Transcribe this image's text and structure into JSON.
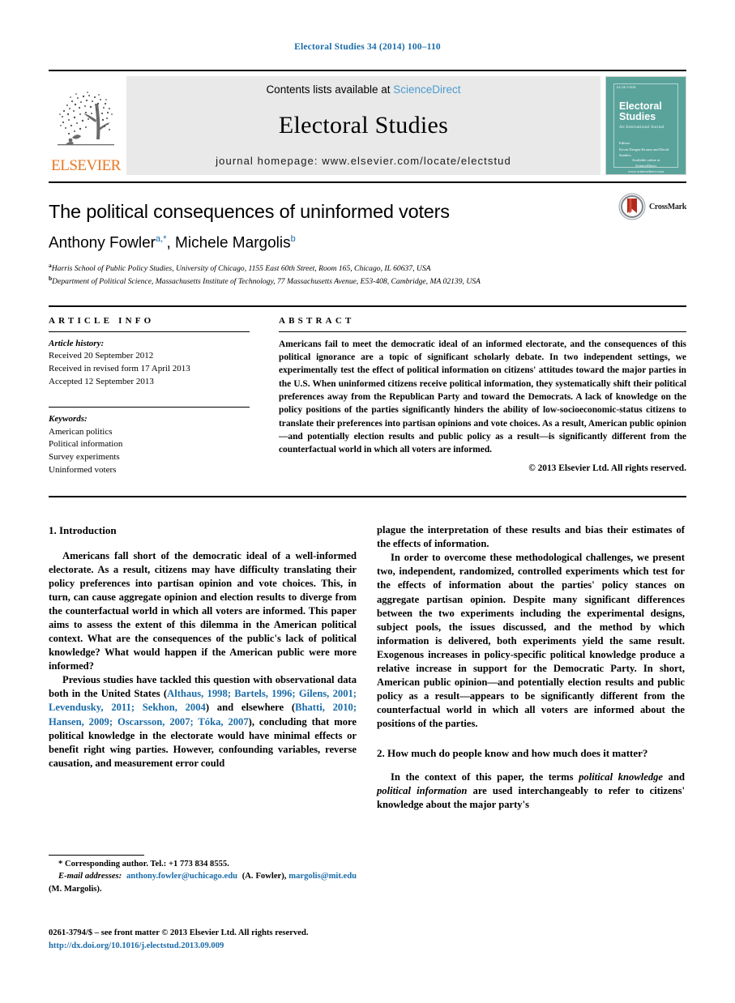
{
  "running_head": "Electoral Studies 34 (2014) 100–110",
  "masthead": {
    "contents_prefix": "Contents lists available at ",
    "sciencedirect": "ScienceDirect",
    "journal_name": "Electoral Studies",
    "homepage": "journal homepage: www.elsevier.com/locate/electstud",
    "publisher_logo_word": "ELSEVIER",
    "cover": {
      "publisher_mark": "ELSEVIER",
      "title_line1": "Electoral",
      "title_line2": "Studies",
      "subtitle": "An International Journal",
      "editors_label": "Editors",
      "editors": "Kevin Deegan-Krause and David Sanders",
      "footer_line1": "Available online at",
      "footer_line2": "ScienceDirect",
      "footer_line3": "www.sciencedirect.com"
    }
  },
  "article": {
    "title": "The political consequences of uninformed voters",
    "authors": [
      {
        "name": "Anthony Fowler",
        "marks": "a,*"
      },
      {
        "name": "Michele Margolis",
        "marks": "b"
      }
    ],
    "authors_separator": ", ",
    "affiliations": [
      {
        "mark": "a",
        "text": "Harris School of Public Policy Studies, University of Chicago, 1155 East 60th Street, Room 165, Chicago, IL 60637, USA"
      },
      {
        "mark": "b",
        "text": "Department of Political Science, Massachusetts Institute of Technology, 77 Massachusetts Avenue, E53-408, Cambridge, MA 02139, USA"
      }
    ],
    "crossmark_label": "CrossMark"
  },
  "article_info": {
    "heading": "ARTICLE INFO",
    "history_label": "Article history:",
    "history": [
      "Received 20 September 2012",
      "Received in revised form 17 April 2013",
      "Accepted 12 September 2013"
    ],
    "keywords_label": "Keywords:",
    "keywords": [
      "American politics",
      "Political information",
      "Survey experiments",
      "Uninformed voters"
    ]
  },
  "abstract": {
    "heading": "ABSTRACT",
    "text": "Americans fail to meet the democratic ideal of an informed electorate, and the consequences of this political ignorance are a topic of significant scholarly debate. In two independent settings, we experimentally test the effect of political information on citizens' attitudes toward the major parties in the U.S. When uninformed citizens receive political information, they systematically shift their political preferences away from the Republican Party and toward the Democrats. A lack of knowledge on the policy positions of the parties significantly hinders the ability of low-socioeconomic-status citizens to translate their preferences into partisan opinions and vote choices. As a result, American public opinion—and potentially election results and public policy as a result—is significantly different from the counterfactual world in which all voters are informed.",
    "copyright": "© 2013 Elsevier Ltd. All rights reserved."
  },
  "body": {
    "left_column": {
      "section1_heading": "1. Introduction",
      "paragraph1": "Americans fall short of the democratic ideal of a well-informed electorate. As a result, citizens may have difficulty translating their policy preferences into partisan opinion and vote choices. This, in turn, can cause aggregate opinion and election results to diverge from the counterfactual world in which all voters are informed. This paper aims to assess the extent of this dilemma in the American political context. What are the consequences of the public's lack of political knowledge? What would happen if the American public were more informed?",
      "paragraph2_part1": "Previous studies have tackled this question with observational data both in the United States (",
      "paragraph2_refs1": "Althaus, 1998; Bartels, 1996; Gilens, 2001; Levendusky, 2011; Sekhon, 2004",
      "paragraph2_part2": ") and elsewhere (",
      "paragraph2_refs2": "Bhatti, 2010; Hansen, 2009; Oscarsson, 2007; Tóka, 2007",
      "paragraph2_part3": "), concluding that more political knowledge in the electorate would have minimal effects or benefit right wing parties. However, confounding variables, reverse causation, and measurement error could"
    },
    "right_column": {
      "paragraph1": "plague the interpretation of these results and bias their estimates of the effects of information.",
      "paragraph2": "In order to overcome these methodological challenges, we present two, independent, randomized, controlled experiments which test for the effects of information about the parties' policy stances on aggregate partisan opinion. Despite many significant differences between the two experiments including the experimental designs, subject pools, the issues discussed, and the method by which information is delivered, both experiments yield the same result. Exogenous increases in policy-specific political knowledge produce a relative increase in support for the Democratic Party. In short, American public opinion—and potentially election results and public policy as a result—appears to be significantly different from the counterfactual world in which all voters are informed about the positions of the parties.",
      "section2_heading": "2. How much do people know and how much does it matter?",
      "paragraph3_part1": "In the context of this paper, the terms ",
      "paragraph3_italic1": "political knowledge",
      "paragraph3_part2": " and ",
      "paragraph3_italic2": "political information",
      "paragraph3_part3": " are used interchangeably to refer to citizens' knowledge about the major party's"
    }
  },
  "footnotes": {
    "corresponding": "* Corresponding author. Tel.: +1 773 834 8555.",
    "email_label": "E-mail addresses:",
    "email1": "anthony.fowler@uchicago.edu",
    "email1_owner": "(A. Fowler),",
    "email2": "margolis@mit.edu",
    "email2_owner": "(M. Margolis)."
  },
  "imprint": {
    "issn_line": "0261-3794/$ – see front matter © 2013 Elsevier Ltd. All rights reserved.",
    "doi": "http://dx.doi.org/10.1016/j.electstud.2013.09.009"
  },
  "colors": {
    "link_blue": "#1b6ca8",
    "sciencedirect_blue": "#4a9bd1",
    "elsevier_orange": "#e87722",
    "cover_teal": "#5aa39b"
  }
}
